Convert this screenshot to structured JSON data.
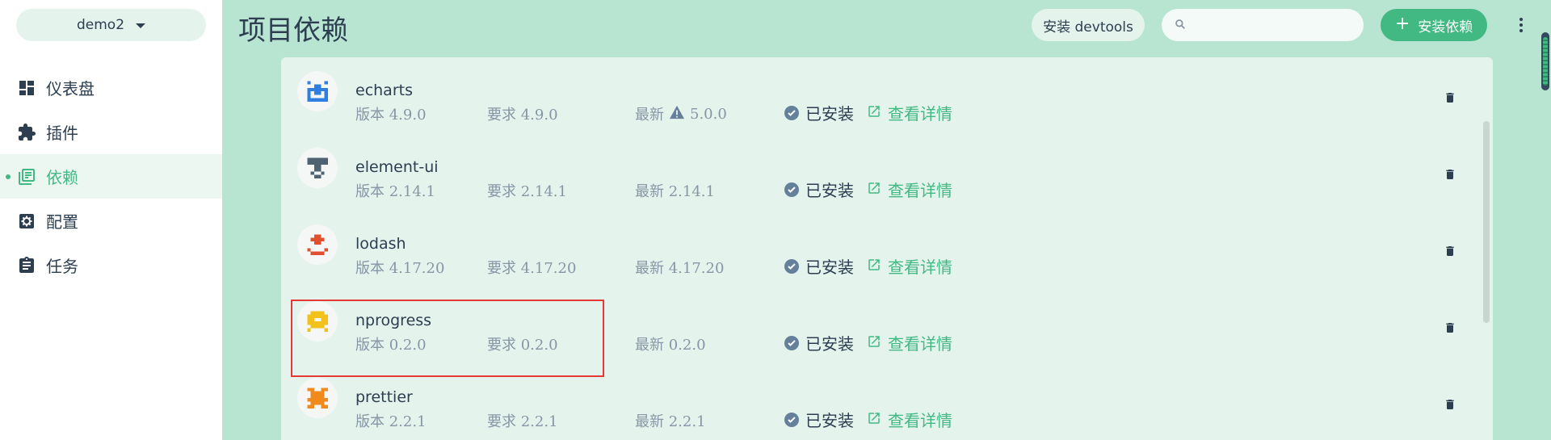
{
  "sidebar": {
    "project": "demo2",
    "items": [
      {
        "label": "仪表盘",
        "icon": "dashboard-icon",
        "active": false
      },
      {
        "label": "插件",
        "icon": "puzzle-icon",
        "active": false
      },
      {
        "label": "依赖",
        "icon": "library-icon",
        "active": true
      },
      {
        "label": "配置",
        "icon": "settings-icon",
        "active": false
      },
      {
        "label": "任务",
        "icon": "clipboard-icon",
        "active": false
      }
    ]
  },
  "header": {
    "title": "项目依赖",
    "devtools_label": "安装 devtools",
    "search_value": "",
    "install_label": "安装依赖"
  },
  "packages": [
    {
      "name": "echarts",
      "version": "版本 4.9.0",
      "required": "要求 4.9.0",
      "latest": "最新",
      "latest_version": "5.0.0",
      "outdated": true,
      "status": "已安装",
      "details": "查看详情",
      "icon_color": "#2f7fe0"
    },
    {
      "name": "element-ui",
      "version": "版本 2.14.1",
      "required": "要求 2.14.1",
      "latest": "最新 2.14.1",
      "latest_version": "",
      "outdated": false,
      "status": "已安装",
      "details": "查看详情",
      "icon_color": "#4f6272"
    },
    {
      "name": "lodash",
      "version": "版本 4.17.20",
      "required": "要求 4.17.20",
      "latest": "最新 4.17.20",
      "latest_version": "",
      "outdated": false,
      "status": "已安装",
      "details": "查看详情",
      "icon_color": "#e0502f"
    },
    {
      "name": "nprogress",
      "version": "版本 0.2.0",
      "required": "要求 0.2.0",
      "latest": "最新 0.2.0",
      "latest_version": "",
      "outdated": false,
      "status": "已安装",
      "details": "查看详情",
      "icon_color": "#f2c21b"
    },
    {
      "name": "prettier",
      "version": "版本 2.2.1",
      "required": "要求 2.2.1",
      "latest": "最新 2.2.1",
      "latest_version": "",
      "outdated": false,
      "status": "已安装",
      "details": "查看详情",
      "icon_color": "#f08a1c"
    }
  ],
  "colors": {
    "accent": "#42b983",
    "main_bg": "#b7e5d2",
    "panel_bg": "#e4f3ec",
    "highlight": "#e53935"
  }
}
